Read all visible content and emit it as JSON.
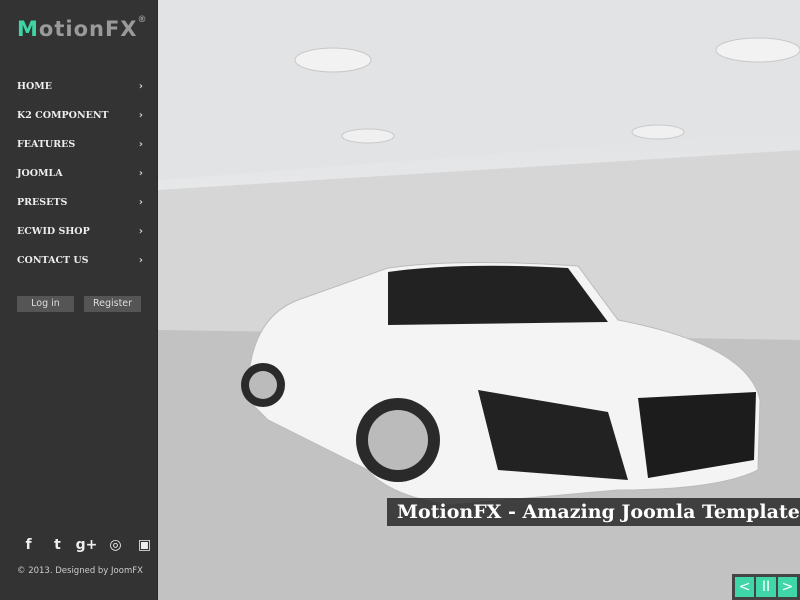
{
  "logo": {
    "first": "M",
    "rest": "otionFX",
    "mark": "®"
  },
  "nav": [
    {
      "label": "HOME"
    },
    {
      "label": "K2 COMPONENT"
    },
    {
      "label": "FEATURES"
    },
    {
      "label": "JOOMLA"
    },
    {
      "label": "PRESETS"
    },
    {
      "label": "ECWID SHOP"
    },
    {
      "label": "CONTACT US"
    }
  ],
  "chevron": "›",
  "auth": {
    "login": "Log in",
    "register": "Register"
  },
  "social": [
    "f",
    "t",
    "g+",
    "◎",
    "▣"
  ],
  "footer": "© 2013. Designed by JoomFX",
  "slide": {
    "caption": "MotionFX - Amazing Joomla Template"
  },
  "controls": {
    "prev": "<",
    "pause": "II",
    "next": ">"
  },
  "colors": {
    "accent": "#3ed6a6",
    "sidebar": "#333333"
  }
}
